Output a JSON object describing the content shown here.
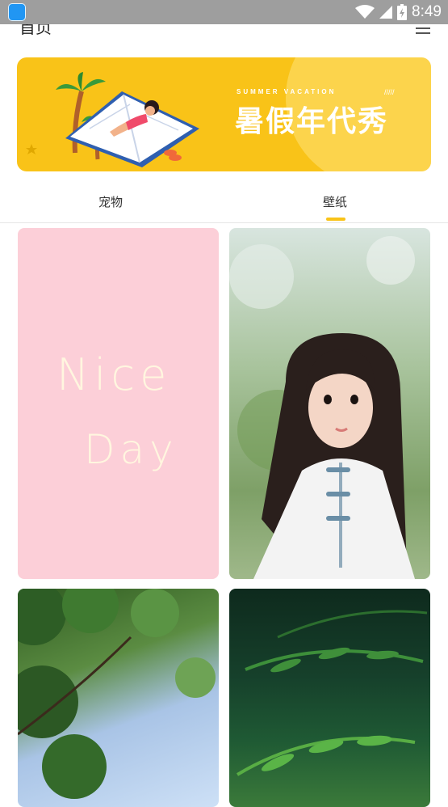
{
  "status_bar": {
    "time": "8:49",
    "icons": [
      "app-icon",
      "wifi-icon",
      "signal-icon",
      "battery-charging-icon"
    ]
  },
  "header": {
    "title": "首页",
    "menu_icon": "menu-icon"
  },
  "banner": {
    "subtitle": "SUMMER VACATION",
    "title": "暑假年代秀",
    "decoration": "/////",
    "illustration": "girl-reading-on-book-with-palm-trees",
    "background_color": "#f9c318"
  },
  "tabs": [
    {
      "label": "宠物",
      "active": false
    },
    {
      "label": "壁纸",
      "active": true
    }
  ],
  "accent_color": "#f9c318",
  "wallpapers": [
    {
      "lines": [
        "Nice",
        "Day"
      ],
      "description": "pink-wallpaper"
    },
    {
      "description": "girl-photo"
    },
    {
      "description": "leaves-sky-photo"
    },
    {
      "description": "green-fern-photo"
    }
  ]
}
